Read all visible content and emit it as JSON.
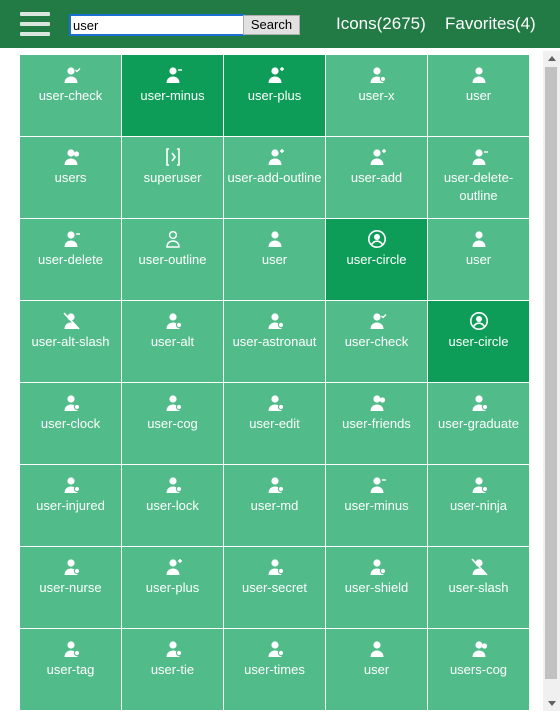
{
  "header": {
    "search": {
      "value": "user",
      "button_label": "Search"
    },
    "icons_link": "Icons(2675)",
    "favorites_link": "Favorites(4)"
  },
  "colors": {
    "header_bg": "#227a45",
    "tile_bg": "#51bc8a",
    "tile_favorite_bg": "#0e9d58"
  },
  "tiles": [
    {
      "label": "user-check",
      "icon": "user-check-icon",
      "dark": false
    },
    {
      "label": "user-minus",
      "icon": "user-minus-icon",
      "dark": true
    },
    {
      "label": "user-plus",
      "icon": "user-plus-icon",
      "dark": true
    },
    {
      "label": "user-x",
      "icon": "user-x-icon",
      "dark": false
    },
    {
      "label": "user",
      "icon": "user-icon",
      "dark": false
    },
    {
      "label": "users",
      "icon": "users-icon",
      "dark": false
    },
    {
      "label": "superuser",
      "icon": "superuser-icon",
      "dark": false
    },
    {
      "label": "user-add-outline",
      "icon": "user-add-outline-icon",
      "dark": false
    },
    {
      "label": "user-add",
      "icon": "user-add-icon",
      "dark": false
    },
    {
      "label": "user-delete-outline",
      "icon": "user-delete-outline-icon",
      "dark": false
    },
    {
      "label": "user-delete",
      "icon": "user-delete-icon",
      "dark": false
    },
    {
      "label": "user-outline",
      "icon": "user-outline-icon",
      "dark": false
    },
    {
      "label": "user",
      "icon": "user-icon",
      "dark": false
    },
    {
      "label": "user-circle",
      "icon": "user-circle-icon",
      "dark": true
    },
    {
      "label": "user",
      "icon": "user-icon",
      "dark": false
    },
    {
      "label": "user-alt-slash",
      "icon": "user-alt-slash-icon",
      "dark": false
    },
    {
      "label": "user-alt",
      "icon": "user-alt-icon",
      "dark": false
    },
    {
      "label": "user-astronaut",
      "icon": "user-astronaut-icon",
      "dark": false
    },
    {
      "label": "user-check",
      "icon": "user-check-icon",
      "dark": false
    },
    {
      "label": "user-circle",
      "icon": "user-circle-icon",
      "dark": true
    },
    {
      "label": "user-clock",
      "icon": "user-clock-icon",
      "dark": false
    },
    {
      "label": "user-cog",
      "icon": "user-cog-icon",
      "dark": false
    },
    {
      "label": "user-edit",
      "icon": "user-edit-icon",
      "dark": false
    },
    {
      "label": "user-friends",
      "icon": "user-friends-icon",
      "dark": false
    },
    {
      "label": "user-graduate",
      "icon": "user-graduate-icon",
      "dark": false
    },
    {
      "label": "user-injured",
      "icon": "user-injured-icon",
      "dark": false
    },
    {
      "label": "user-lock",
      "icon": "user-lock-icon",
      "dark": false
    },
    {
      "label": "user-md",
      "icon": "user-md-icon",
      "dark": false
    },
    {
      "label": "user-minus",
      "icon": "user-minus-icon",
      "dark": false
    },
    {
      "label": "user-ninja",
      "icon": "user-ninja-icon",
      "dark": false
    },
    {
      "label": "user-nurse",
      "icon": "user-nurse-icon",
      "dark": false
    },
    {
      "label": "user-plus",
      "icon": "user-plus-icon",
      "dark": false
    },
    {
      "label": "user-secret",
      "icon": "user-secret-icon",
      "dark": false
    },
    {
      "label": "user-shield",
      "icon": "user-shield-icon",
      "dark": false
    },
    {
      "label": "user-slash",
      "icon": "user-slash-icon",
      "dark": false
    },
    {
      "label": "user-tag",
      "icon": "user-tag-icon",
      "dark": false
    },
    {
      "label": "user-tie",
      "icon": "user-tie-icon",
      "dark": false
    },
    {
      "label": "user-times",
      "icon": "user-times-icon",
      "dark": false
    },
    {
      "label": "user",
      "icon": "user-icon",
      "dark": false
    },
    {
      "label": "users-cog",
      "icon": "users-cog-icon",
      "dark": false
    }
  ]
}
